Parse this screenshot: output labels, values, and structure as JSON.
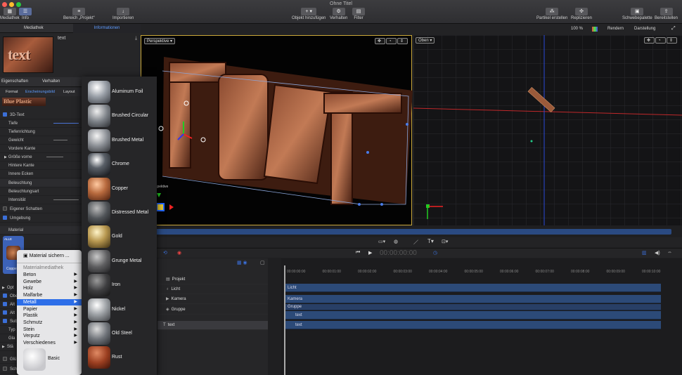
{
  "app": {
    "title": "Ohne Titel"
  },
  "toolbar": {
    "mediathek": "Mediathek",
    "info": "Info",
    "bereich": "Bereich „Projekt“",
    "importieren": "Importieren",
    "objekt": "Objekt hinzufügen",
    "verhalten": "Verhalten",
    "filter": "Filter",
    "partikel": "Partikel erstellen",
    "replizieren": "Replizieren",
    "schwebepalette": "Schwebepalette",
    "bereitstellen": "Bereitstellen"
  },
  "browser": {
    "tab_mediathek": "Mediathek",
    "tab_info": "Informationen",
    "item_name": "text",
    "preview_text": "text"
  },
  "inspector": {
    "tabs": [
      "Eigenschaften",
      "Verhalten"
    ],
    "subtabs": [
      "Format",
      "Erscheinungsbild",
      "Layout"
    ],
    "style_preview": "Blue Plastic",
    "rows": {
      "text3d": "3D-Text",
      "tiefe": "Tiefe",
      "tiefenrichtung": "Tiefenrichtung",
      "gewicht": "Gewicht",
      "vordere_kante": "Vordere Kante",
      "groesse_vorne": "Größe vorne",
      "hintere_kante": "Hintere Kante",
      "innere_ecken": "Innere Ecken",
      "beleuchtung": "Beleuchtung",
      "beleuchtungsart": "Beleuchtungsart",
      "intensitaet": "Intensität",
      "eigener_schatten": "Eigener Schatten",
      "umgebung": "Umgebung",
      "material": "Material",
      "alle": "ALLE",
      "copper": "Coppe",
      "opt": "Opt",
      "obe": "Obe",
      "alt": "Alt",
      "alt2": "Alt",
      "sub": "Sub",
      "typ": "Typ",
      "gla": "Gla",
      "sta": "Stä",
      "glu": "Glü",
      "sch": "Sch"
    }
  },
  "viewer": {
    "perspective": "Perspektive",
    "perspective_small": "spektive",
    "top_label": "Oben",
    "zoom": "100 %",
    "render": "Rendern",
    "darstellung": "Darstellung"
  },
  "menu1": {
    "save": "Material sichern ...",
    "header": "Materialmediathek",
    "items": [
      "Beton",
      "Gewebe",
      "Holz",
      "Malfarbe",
      "Metall",
      "Papier",
      "Plastik",
      "Schmutz",
      "Stein",
      "Verputz",
      "Verschiedenes"
    ],
    "selected": "Metall",
    "basic": "Basic"
  },
  "menu2": {
    "items": [
      "Aluminum Foil",
      "Brushed Circular",
      "Brushed Metal",
      "Chrome",
      "Copper",
      "Distressed Metal",
      "Gold",
      "Grunge Metal",
      "Iron",
      "Nickel",
      "Old Steel",
      "Rust"
    ]
  },
  "timeline": {
    "timecode": "00:00:00:00",
    "layers": [
      "Projekt",
      "Licht",
      "Kamera",
      "Gruppe",
      "text"
    ],
    "bars": [
      "Licht",
      "Kamera",
      "Gruppe",
      "text",
      "text"
    ],
    "ruler": [
      "00:00:00:00",
      "00:00:01:00",
      "00:00:02:00",
      "00:00:03:00",
      "00:00:04:00",
      "00:00:05:00",
      "00:00:06:00",
      "00:00:07:00",
      "00:00:08:00",
      "00:00:09:00",
      "00:00:10:00"
    ]
  }
}
